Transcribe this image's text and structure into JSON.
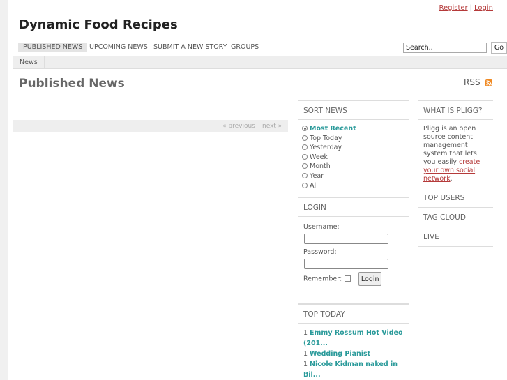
{
  "header": {
    "register_label": "Register",
    "separator": "|",
    "login_label": "Login",
    "site_title": "Dynamic Food Recipes"
  },
  "nav": {
    "items": [
      "Published News",
      "Upcoming News",
      "Submit a New Story",
      "Groups"
    ],
    "active_index": 0
  },
  "search": {
    "value": "Search..",
    "go_label": "Go"
  },
  "subnav": {
    "tab": "News"
  },
  "main": {
    "heading": "Published News",
    "rss_label": "RSS",
    "prev_label": "« previous",
    "next_label": "next »"
  },
  "sort_news": {
    "title": "Sort News",
    "options": [
      "Most Recent",
      "Top Today",
      "Yesterday",
      "Week",
      "Month",
      "Year",
      "All"
    ],
    "selected_index": 0
  },
  "login_box": {
    "title": "Login",
    "username_label": "Username:",
    "password_label": "Password:",
    "remember_label": "Remember:",
    "submit_label": "Login"
  },
  "top_today": {
    "title": "Top Today",
    "items": [
      {
        "rank": "1",
        "title_line1": "Emmy Rossum Hot Video",
        "title_line2": "(201..."
      },
      {
        "rank": "1",
        "title_line1": "Wedding Pianist",
        "title_line2": ""
      },
      {
        "rank": "1",
        "title_line1": "Nicole Kidman naked in",
        "title_line2": "Bil..."
      }
    ]
  },
  "sidebar": {
    "what_is_title": "What is Pligg?",
    "what_is_text": "Pligg is an open source content management system that lets you easily ",
    "what_is_link": "create your own social network",
    "what_is_end": ".",
    "top_users": "Top Users",
    "tag_cloud": "Tag Cloud",
    "live": "Live"
  },
  "colors": {
    "accent_link": "#b53a3a",
    "teal": "#2a9a9a",
    "rss": "#f08a24"
  }
}
